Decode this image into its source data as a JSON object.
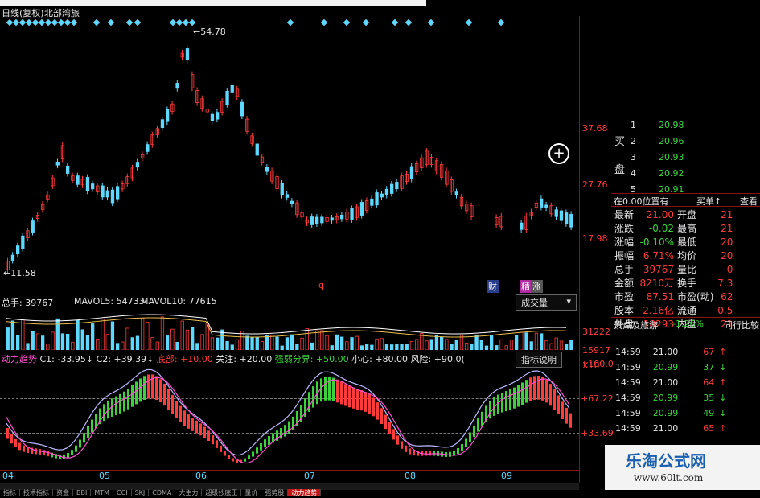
{
  "header": {
    "title": "日线(复权)",
    "subtitle": "北部湾旅",
    "top_cut": "·",
    "top_right_cut": "---"
  },
  "main_chart": {
    "high_label": "54.78",
    "low_label": "11.58",
    "price_scale": [
      "37.68",
      "27.76",
      "17.98"
    ],
    "markers": {
      "q": "q",
      "cai": "财",
      "jing": "精",
      "fu": "涨"
    },
    "zoom_icon": "plus-circle-icon"
  },
  "volume": {
    "label": "总手: 39767",
    "mavol5": "MAVOL5: 54733",
    "mavol10": "MAVOL10: 77615",
    "dropdown": "成交量",
    "scale": [
      "31222",
      "15917",
      "X10"
    ]
  },
  "indicator": {
    "name": "动力趋势",
    "c1": "C1: -33.95",
    "c2": "C2: +39.39",
    "bottom": "底部: +10.00",
    "watch": "关注: +20.00",
    "strongweak": "强弱分界: +50.00",
    "careful": "小心: +80.00",
    "risk": "风险: +90.0(",
    "explain_btn": "指标说明",
    "scale": [
      "+100.0",
      "+67.22",
      "+33.69"
    ]
  },
  "x_axis": [
    "04",
    "05",
    "06",
    "07",
    "08",
    "09"
  ],
  "bottom_tabs": [
    "指标",
    "技术指标",
    "资金",
    "BBI",
    "MTM",
    "CCI",
    "SKJ",
    "CDMA",
    "大主力",
    "超级抄底王",
    "量价",
    "强势股",
    "动力趋势"
  ],
  "order_book": {
    "label_buy": "买",
    "label_pan": "盘",
    "rows": [
      {
        "level": "1",
        "price": "20.98"
      },
      {
        "level": "2",
        "price": "20.96"
      },
      {
        "level": "3",
        "price": "20.93"
      },
      {
        "level": "4",
        "price": "20.92"
      },
      {
        "level": "5",
        "price": "20.91"
      }
    ]
  },
  "position_bar": {
    "left": "在0.00位置有",
    "mid": "买单",
    "right": "查看"
  },
  "quote": [
    {
      "k1": "最新",
      "v1": "21.00",
      "k2": "开盘",
      "v2": "21"
    },
    {
      "k1": "涨跌",
      "v1": "-0.02",
      "k2": "最高",
      "v2": "21"
    },
    {
      "k1": "涨幅",
      "v1": "-0.10%",
      "k2": "最低",
      "v2": "20"
    },
    {
      "k1": "振幅",
      "v1": "6.71%",
      "k2": "均价",
      "v2": "20"
    },
    {
      "k1": "总手",
      "v1": "39767",
      "k2": "量比",
      "v2": "0"
    },
    {
      "k1": "金额",
      "v1": "8210万",
      "k2": "换手",
      "v2": "7.3"
    },
    {
      "k1": "市盈",
      "v1": "87.51",
      "k2": "市盈(动)",
      "v2": "62"
    },
    {
      "k1": "股本",
      "v1": "2.16亿",
      "k2": "流通",
      "v2": "0.5"
    },
    {
      "k1": "外盘",
      "v1": "18293",
      "k2": "内盘",
      "v2": "21"
    }
  ],
  "tick_header": {
    "left": "景点及旅游",
    "pct": "-1.26%",
    "right": "同行比较"
  },
  "ticks": [
    {
      "time": "14:59",
      "price": "21.00",
      "vol": "67",
      "dir": "up"
    },
    {
      "time": "14:59",
      "price": "20.99",
      "vol": "37",
      "dir": "down"
    },
    {
      "time": "14:59",
      "price": "21.00",
      "vol": "64",
      "dir": "up"
    },
    {
      "time": "14:59",
      "price": "20.99",
      "vol": "35",
      "dir": "down"
    },
    {
      "time": "14:59",
      "price": "20.99",
      "vol": "49",
      "dir": "down"
    },
    {
      "time": "14:59",
      "price": "21.00",
      "vol": "65",
      "dir": "up"
    }
  ],
  "watermark": {
    "title": "乐淘公式网",
    "url": "www.60lt.com"
  },
  "colors": {
    "up": "#ff3b3b",
    "down": "#5fd8ff",
    "ma_green": "#3ad43a",
    "bg": "#000000"
  }
}
